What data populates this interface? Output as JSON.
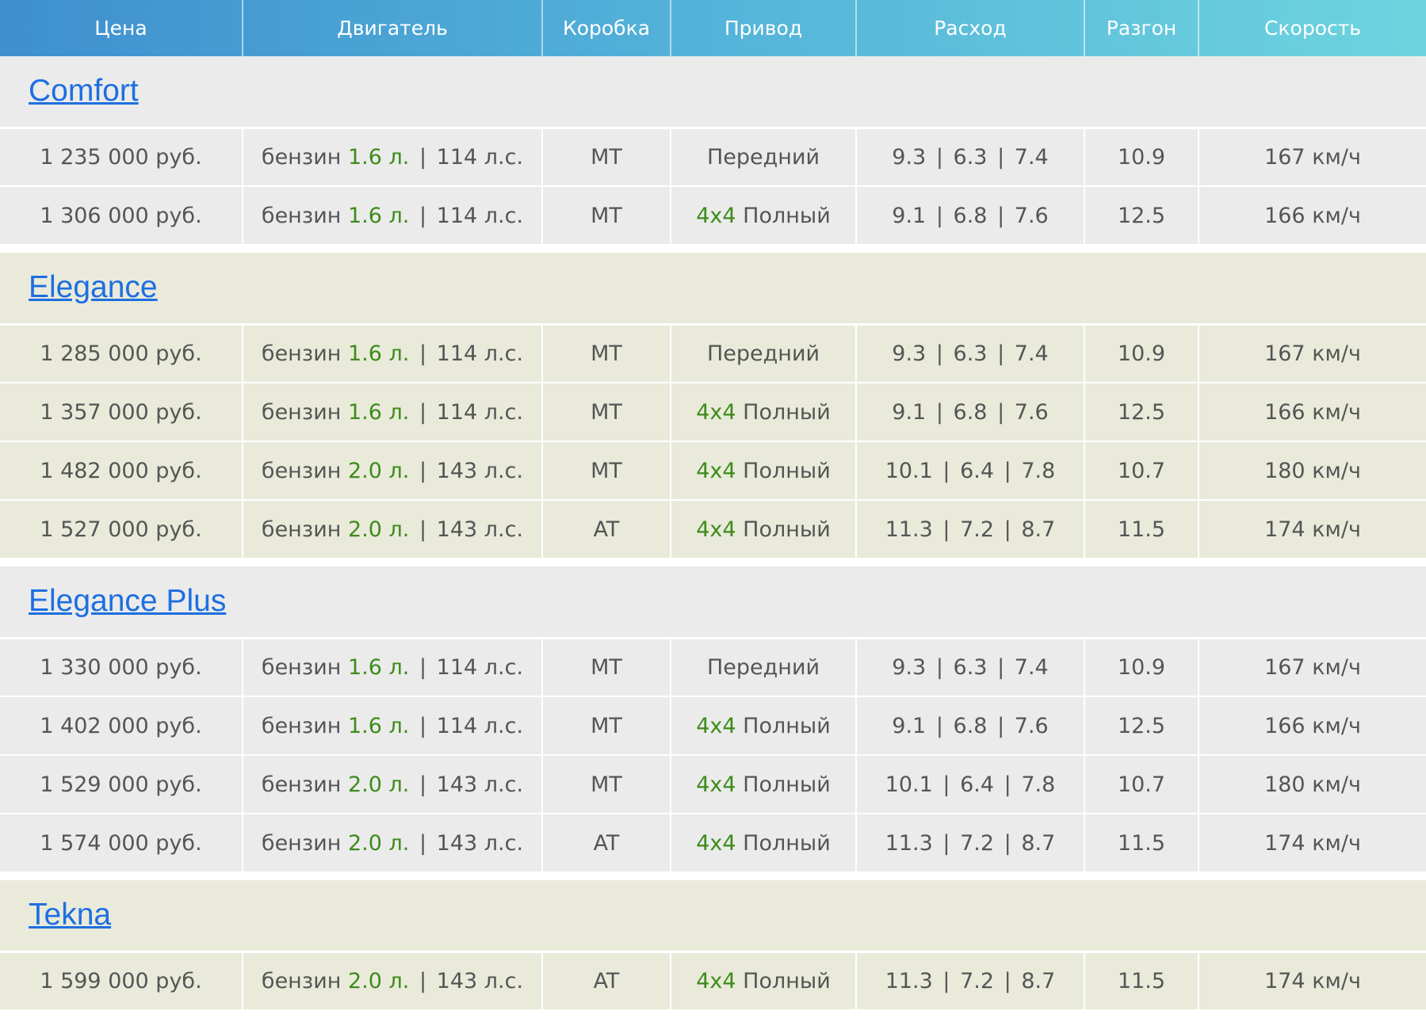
{
  "columns": [
    "Цена",
    "Двигатель",
    "Коробка",
    "Привод",
    "Расход",
    "Разгон",
    "Скорость"
  ],
  "colors": {
    "accent_green": "#3c8c1a",
    "link_blue": "#1d6fe0"
  },
  "groups": [
    {
      "name": "Comfort",
      "style": "grey",
      "rows": [
        {
          "price": "1 235 000 руб.",
          "fuel": "бензин",
          "volume": "1.6 л.",
          "power": "114 л.с.",
          "gearbox": "MT",
          "drive_prefix": "",
          "drive": "Передний",
          "cons_city": "9.3",
          "cons_highway": "6.3",
          "cons_mixed": "7.4",
          "accel": "10.9",
          "speed": "167 км/ч"
        },
        {
          "price": "1 306 000 руб.",
          "fuel": "бензин",
          "volume": "1.6 л.",
          "power": "114 л.с.",
          "gearbox": "MT",
          "drive_prefix": "4x4",
          "drive": "Полный",
          "cons_city": "9.1",
          "cons_highway": "6.8",
          "cons_mixed": "7.6",
          "accel": "12.5",
          "speed": "166 км/ч"
        }
      ]
    },
    {
      "name": "Elegance",
      "style": "beige",
      "rows": [
        {
          "price": "1 285 000 руб.",
          "fuel": "бензин",
          "volume": "1.6 л.",
          "power": "114 л.с.",
          "gearbox": "MT",
          "drive_prefix": "",
          "drive": "Передний",
          "cons_city": "9.3",
          "cons_highway": "6.3",
          "cons_mixed": "7.4",
          "accel": "10.9",
          "speed": "167 км/ч"
        },
        {
          "price": "1 357 000 руб.",
          "fuel": "бензин",
          "volume": "1.6 л.",
          "power": "114 л.с.",
          "gearbox": "MT",
          "drive_prefix": "4x4",
          "drive": "Полный",
          "cons_city": "9.1",
          "cons_highway": "6.8",
          "cons_mixed": "7.6",
          "accel": "12.5",
          "speed": "166 км/ч"
        },
        {
          "price": "1 482 000 руб.",
          "fuel": "бензин",
          "volume": "2.0 л.",
          "power": "143 л.с.",
          "gearbox": "MT",
          "drive_prefix": "4x4",
          "drive": "Полный",
          "cons_city": "10.1",
          "cons_highway": "6.4",
          "cons_mixed": "7.8",
          "accel": "10.7",
          "speed": "180 км/ч"
        },
        {
          "price": "1 527 000 руб.",
          "fuel": "бензин",
          "volume": "2.0 л.",
          "power": "143 л.с.",
          "gearbox": "AT",
          "drive_prefix": "4x4",
          "drive": "Полный",
          "cons_city": "11.3",
          "cons_highway": "7.2",
          "cons_mixed": "8.7",
          "accel": "11.5",
          "speed": "174 км/ч"
        }
      ]
    },
    {
      "name": "Elegance Plus",
      "style": "grey",
      "rows": [
        {
          "price": "1 330 000 руб.",
          "fuel": "бензин",
          "volume": "1.6 л.",
          "power": "114 л.с.",
          "gearbox": "MT",
          "drive_prefix": "",
          "drive": "Передний",
          "cons_city": "9.3",
          "cons_highway": "6.3",
          "cons_mixed": "7.4",
          "accel": "10.9",
          "speed": "167 км/ч"
        },
        {
          "price": "1 402 000 руб.",
          "fuel": "бензин",
          "volume": "1.6 л.",
          "power": "114 л.с.",
          "gearbox": "MT",
          "drive_prefix": "4x4",
          "drive": "Полный",
          "cons_city": "9.1",
          "cons_highway": "6.8",
          "cons_mixed": "7.6",
          "accel": "12.5",
          "speed": "166 км/ч"
        },
        {
          "price": "1 529 000 руб.",
          "fuel": "бензин",
          "volume": "2.0 л.",
          "power": "143 л.с.",
          "gearbox": "MT",
          "drive_prefix": "4x4",
          "drive": "Полный",
          "cons_city": "10.1",
          "cons_highway": "6.4",
          "cons_mixed": "7.8",
          "accel": "10.7",
          "speed": "180 км/ч"
        },
        {
          "price": "1 574 000 руб.",
          "fuel": "бензин",
          "volume": "2.0 л.",
          "power": "143 л.с.",
          "gearbox": "AT",
          "drive_prefix": "4x4",
          "drive": "Полный",
          "cons_city": "11.3",
          "cons_highway": "7.2",
          "cons_mixed": "8.7",
          "accel": "11.5",
          "speed": "174 км/ч"
        }
      ]
    },
    {
      "name": "Tekna",
      "style": "beige",
      "rows": [
        {
          "price": "1 599 000 руб.",
          "fuel": "бензин",
          "volume": "2.0 л.",
          "power": "143 л.с.",
          "gearbox": "AT",
          "drive_prefix": "4x4",
          "drive": "Полный",
          "cons_city": "11.3",
          "cons_highway": "7.2",
          "cons_mixed": "8.7",
          "accel": "11.5",
          "speed": "174 км/ч"
        }
      ]
    }
  ]
}
